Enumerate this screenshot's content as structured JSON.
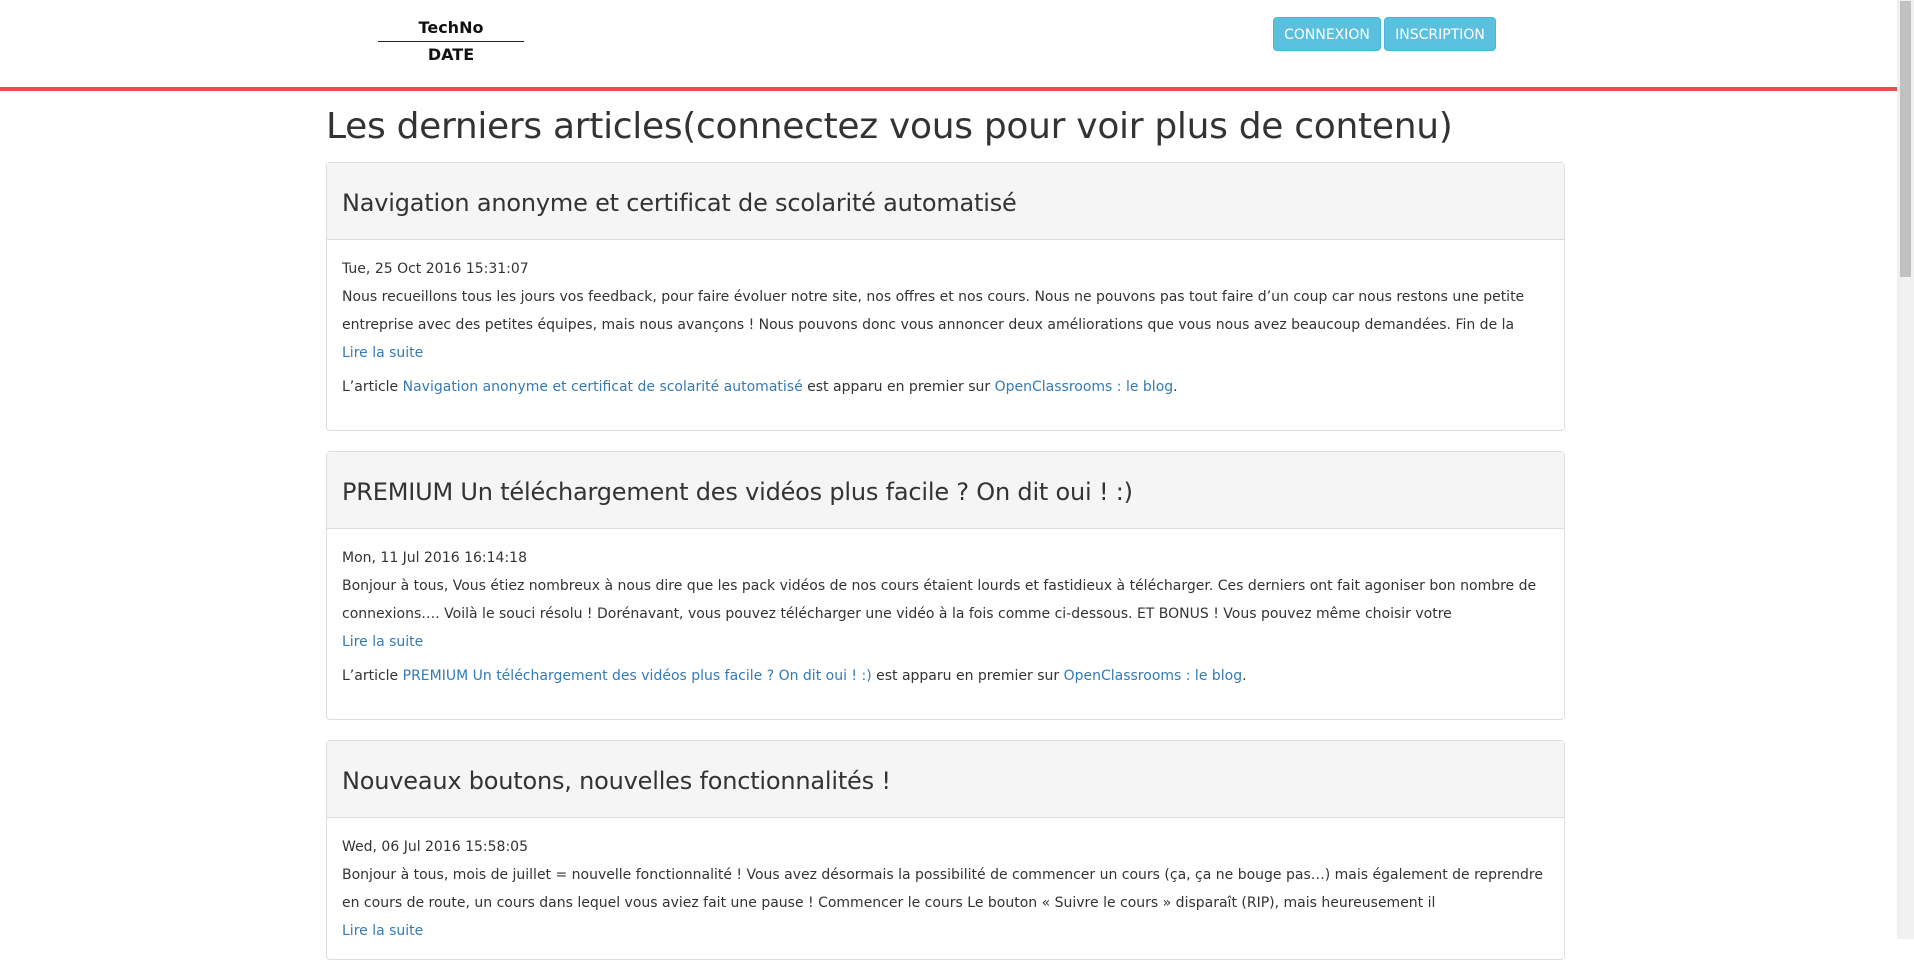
{
  "header": {
    "logo_top": "TechNo",
    "logo_bottom": "DATE",
    "login_label": "CONNEXION",
    "register_label": "INSCRIPTION"
  },
  "page_title": "Les derniers articles(connectez vous pour voir plus de contenu)",
  "articles": [
    {
      "title": "Navigation anonyme et certificat de scolarité automatisé",
      "date": "Tue, 25 Oct 2016 15:31:07",
      "excerpt": "Nous recueillons tous les jours vos feedback, pour faire évoluer notre site, nos offres et nos cours. Nous ne pouvons pas tout faire d’un coup car nous restons une petite entreprise avec des petites équipes, mais nous avançons ! Nous pouvons donc vous annoncer deux améliorations que vous nous avez beaucoup demandées. Fin de la",
      "read_more": "Lire la suite",
      "footer_prefix": "L’article",
      "footer_link": "Navigation anonyme et certificat de scolarité automatisé",
      "footer_middle": "est apparu en premier sur",
      "footer_blog": "OpenClassrooms : le blog",
      "footer_end": "."
    },
    {
      "title": "PREMIUM Un téléchargement des vidéos plus facile ? On dit oui ! :)",
      "date": "Mon, 11 Jul 2016 16:14:18",
      "excerpt": "Bonjour à tous,   Vous étiez nombreux à nous dire que les pack vidéos de nos cours étaient lourds et fastidieux à télécharger. Ces derniers ont fait agoniser bon nombre de connexions…. Voilà le souci résolu ! Dorénavant, vous pouvez télécharger une vidéo à la fois comme ci-dessous. ET BONUS ! Vous pouvez même choisir votre",
      "read_more": "Lire la suite",
      "footer_prefix": "L’article",
      "footer_link": "PREMIUM Un téléchargement des vidéos plus facile ? On dit oui ! :)",
      "footer_middle": "est apparu en premier sur",
      "footer_blog": "OpenClassrooms : le blog",
      "footer_end": "."
    },
    {
      "title": "Nouveaux boutons, nouvelles fonctionnalités !",
      "date": "Wed, 06 Jul 2016 15:58:05",
      "excerpt": "Bonjour à tous, mois de juillet = nouvelle fonctionnalité ! Vous avez désormais la possibilité de commencer un cours (ça, ça ne bouge pas…) mais également de reprendre en cours de route, un cours dans lequel vous aviez fait une pause ! Commencer le cours Le bouton « Suivre le cours » disparaît (RIP), mais heureusement il",
      "read_more": "Lire la suite"
    }
  ]
}
